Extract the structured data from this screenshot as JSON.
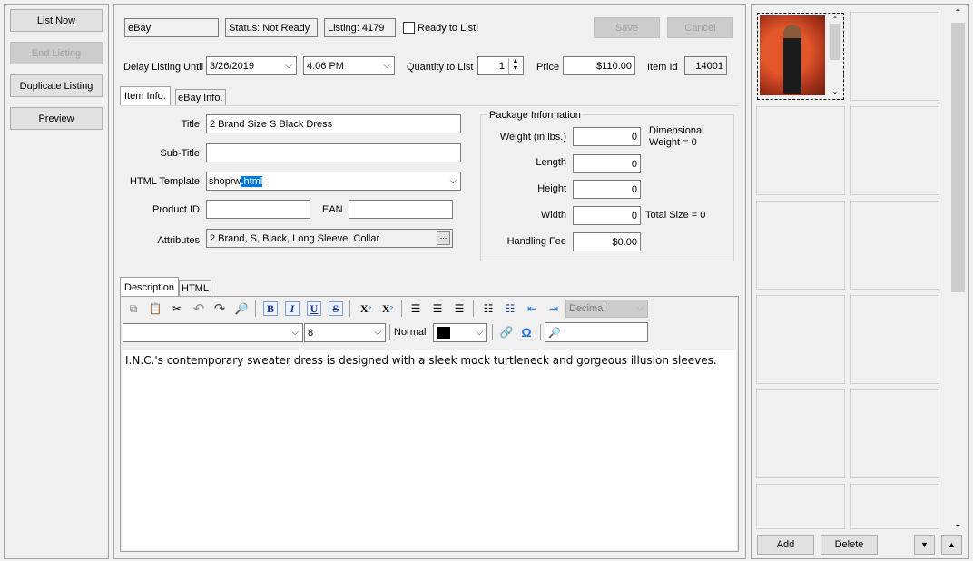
{
  "left": {
    "buttons": [
      {
        "label": "List Now",
        "enabled": true
      },
      {
        "label": "End Listing",
        "enabled": false
      },
      {
        "label": "Duplicate Listing",
        "enabled": true
      },
      {
        "label": "Preview",
        "enabled": true
      }
    ]
  },
  "header": {
    "channel": "eBay",
    "status": "Status: Not Ready",
    "listing": "Listing: 4179",
    "ready_label": "Ready to List!",
    "ready_checked": false,
    "save": "Save",
    "cancel": "Cancel"
  },
  "row2": {
    "delay_label": "Delay Listing Until",
    "date": "3/26/2019",
    "time": "4:06 PM",
    "qty_label": "Quantity to List",
    "qty": "1",
    "price_label": "Price",
    "price": "$110.00",
    "itemid_label": "Item Id",
    "itemid": "14001"
  },
  "tabs": [
    "Item Info.",
    "eBay Info."
  ],
  "item": {
    "title_label": "Title",
    "title": "2 Brand Size S Black Dress",
    "subtitle_label": "Sub-Title",
    "subtitle": "",
    "template_label": "HTML Template",
    "template_prefix": "shoprw",
    "template_selected": ".html",
    "productid_label": "Product ID",
    "productid": "",
    "ean_label": "EAN",
    "ean": "",
    "attributes_label": "Attributes",
    "attributes": "2 Brand, S, Black, Long Sleeve, Collar",
    "ellipsis": "..."
  },
  "package": {
    "legend": "Package Information",
    "weight_label": "Weight (in lbs.)",
    "weight": "0",
    "dim_weight": "Dimensional Weight = 0",
    "length_label": "Length",
    "length": "0",
    "height_label": "Height",
    "height": "0",
    "width_label": "Width",
    "width": "0",
    "total_size": "Total Size = 0",
    "handling_label": "Handling Fee",
    "handling": "$0.00"
  },
  "editor": {
    "tabs": [
      "Description",
      "HTML"
    ],
    "list_style": "Decimal",
    "font": "",
    "size": "8",
    "paragraph": "Normal",
    "color": "#000000",
    "text": "I.N.C.'s contemporary sweater dress is designed with a sleek mock turtleneck and gorgeous illusion sleeves."
  },
  "images": {
    "add": "Add",
    "delete": "Delete"
  },
  "colors": {
    "selection": "#0078d7",
    "accent_icon": "#1a6fd6"
  }
}
